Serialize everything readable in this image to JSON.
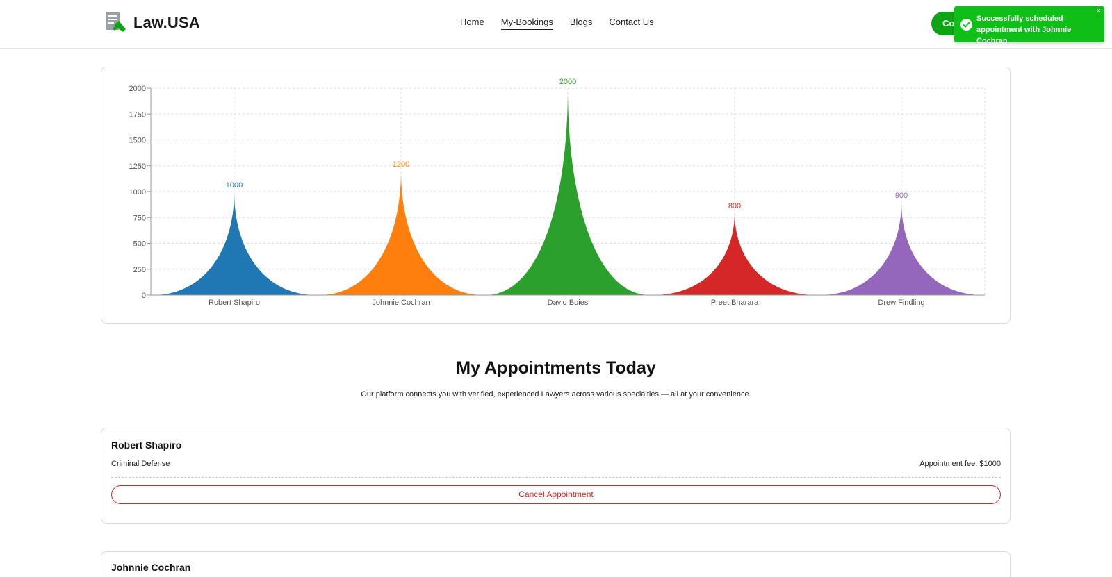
{
  "header": {
    "brand": "Law.USA",
    "nav": [
      "Home",
      "My-Bookings",
      "Blogs",
      "Contact Us"
    ],
    "active_nav": "My-Bookings",
    "cta_label": "Co"
  },
  "toast": {
    "message": "Successfully scheduled appointment with Johnnie Cochran",
    "close_label": "×"
  },
  "chart_data": {
    "type": "area",
    "categories": [
      "Robert Shapiro",
      "Johnnie Cochran",
      "David Boies",
      "Preet Bharara",
      "Drew Findling"
    ],
    "values": [
      1000,
      1200,
      2000,
      800,
      900
    ],
    "colors": [
      "#1f77b4",
      "#ff7f0e",
      "#2ca02c",
      "#d62728",
      "#9467bd"
    ],
    "ylim": [
      0,
      2000
    ],
    "yticks": [
      0,
      250,
      500,
      750,
      1000,
      1250,
      1500,
      1750,
      2000
    ],
    "grid": true,
    "title": "",
    "xlabel": "",
    "ylabel": ""
  },
  "section": {
    "title": "My Appointments Today",
    "subtitle": "Our platform connects you with verified, experienced Lawyers across various specialties — all at your convenience."
  },
  "bookings": [
    {
      "name": "Robert Shapiro",
      "specialty": "Criminal Defense",
      "fee": "Appointment fee: $1000",
      "cancel_label": "Cancel Appointment"
    },
    {
      "name": "Johnnie Cochran"
    }
  ]
}
